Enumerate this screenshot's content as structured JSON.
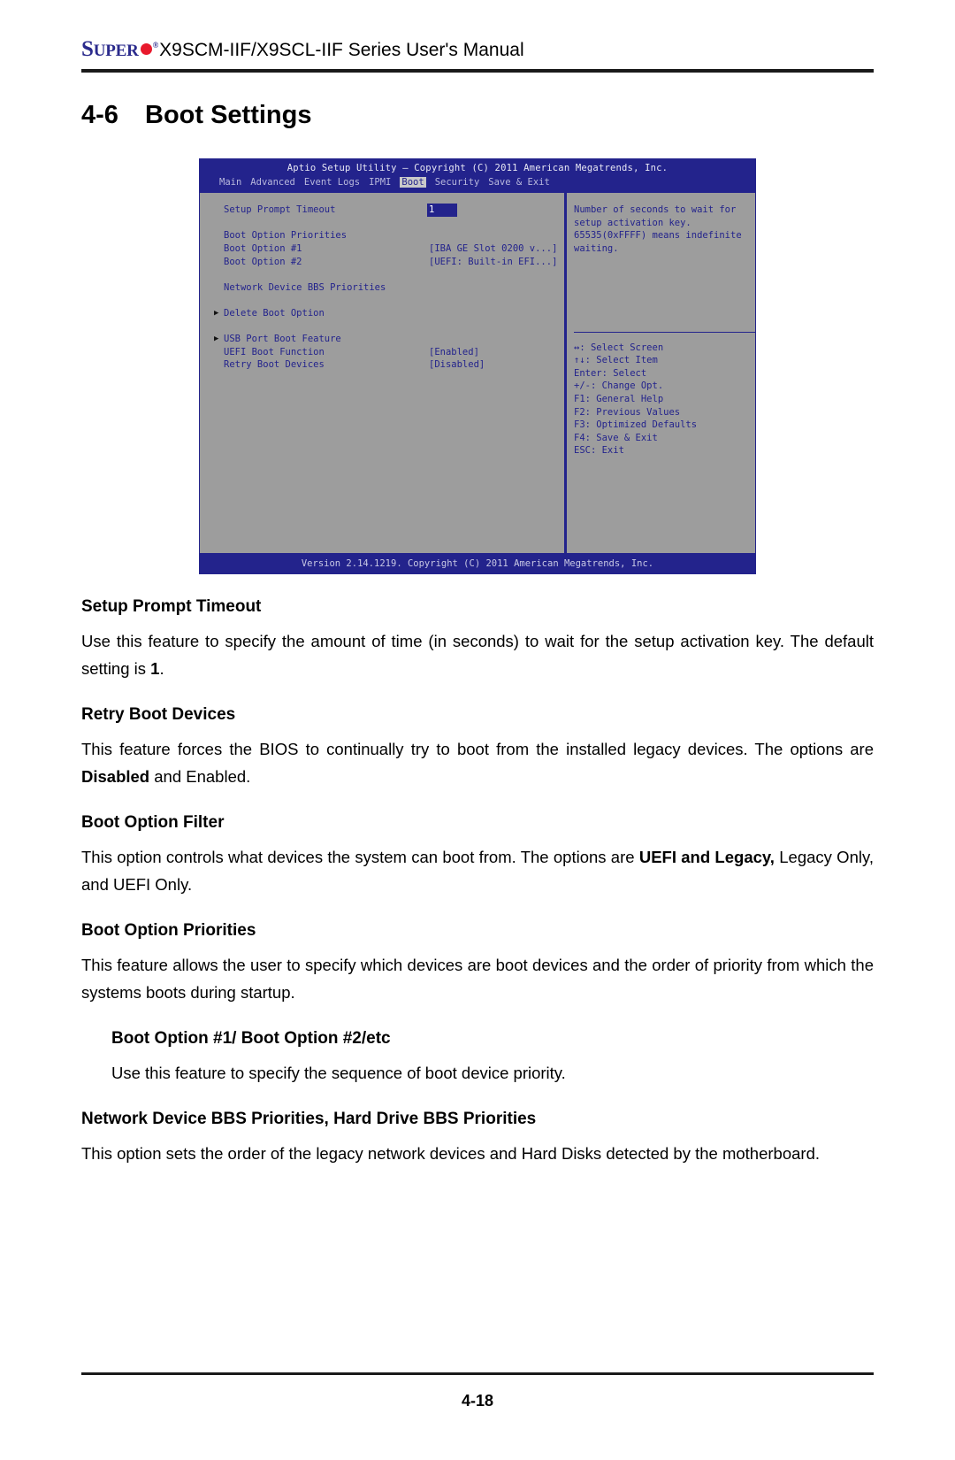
{
  "header": {
    "brand_super": "S",
    "brand_uper": "UPER",
    "brand_reg": "®",
    "title": "X9SCM-IIF/X9SCL-IIF Series User's Manual"
  },
  "section": {
    "number": "4-6",
    "title": "Boot Settings"
  },
  "bios": {
    "titlebar": "Aptio Setup Utility – Copyright (C) 2011 American Megatrends, Inc.",
    "menu": [
      {
        "label": "Main",
        "active": false
      },
      {
        "label": "Advanced",
        "active": false
      },
      {
        "label": "Event Logs",
        "active": false
      },
      {
        "label": "IPMI",
        "active": false
      },
      {
        "label": "Boot",
        "active": true
      },
      {
        "label": "Security",
        "active": false
      },
      {
        "label": "Save & Exit",
        "active": false
      }
    ],
    "rows": [
      {
        "arrow": "",
        "label": "Setup Prompt Timeout",
        "value": "1",
        "selected": true
      },
      {
        "arrow": "",
        "label": "",
        "value": "",
        "selected": false
      },
      {
        "arrow": "",
        "label": "Boot Option Priorities",
        "value": "",
        "selected": false
      },
      {
        "arrow": "",
        "label": "Boot Option #1",
        "value": "[IBA GE Slot 0200 v...]",
        "selected": false
      },
      {
        "arrow": "",
        "label": "Boot Option #2",
        "value": "[UEFI: Built-in EFI...]",
        "selected": false
      },
      {
        "arrow": "",
        "label": "",
        "value": "",
        "selected": false
      },
      {
        "arrow": "",
        "label": "Network Device BBS Priorities",
        "value": "",
        "selected": false
      },
      {
        "arrow": "",
        "label": "",
        "value": "",
        "selected": false
      },
      {
        "arrow": "▶",
        "label": "Delete Boot Option",
        "value": "",
        "selected": false
      },
      {
        "arrow": "",
        "label": "",
        "value": "",
        "selected": false
      },
      {
        "arrow": "▶",
        "label": "USB Port Boot Feature",
        "value": "",
        "selected": false
      },
      {
        "arrow": "",
        "label": "UEFI Boot Function",
        "value": "[Enabled]",
        "selected": false
      },
      {
        "arrow": "",
        "label": "Retry Boot Devices",
        "value": "[Disabled]",
        "selected": false
      }
    ],
    "help": "Number of seconds to wait for\nsetup activation key.\n65535(0xFFFF) means indefinite\nwaiting.",
    "keys": [
      "↔: Select Screen",
      "↑↓: Select Item",
      "Enter: Select",
      "+/-: Change Opt.",
      "F1: General Help",
      "F2: Previous Values",
      "F3: Optimized Defaults",
      "F4: Save & Exit",
      "ESC: Exit"
    ],
    "footer": "Version 2.14.1219. Copyright (C) 2011 American Megatrends, Inc."
  },
  "content": {
    "s1_head": "Setup Prompt Timeout",
    "s1_p1a": "Use this feature to specify the amount of time (in seconds) to wait for the setup activation key. The default setting is ",
    "s1_p1b": "1",
    "s1_p1c": ".",
    "s2_head": "Retry Boot Devices",
    "s2_p1a": "This feature forces the BIOS to continually try to boot from the installed legacy devices.  The options are ",
    "s2_p1b": "Disabled",
    "s2_p1c": " and Enabled.",
    "s3_head": "Boot Option Filter",
    "s3_p1a": "This option controls what devices the system can boot from.  The options are ",
    "s3_p1b": "UEFI and Legacy,",
    "s3_p1c": " Legacy Only, and UEFI Only.",
    "s4_head": "Boot Option Priorities",
    "s4_p1": "This feature allows the user to specify which devices are boot devices and the order of priority from which the systems boots during startup.",
    "s5_head": "Boot Option #1/ Boot Option #2/etc",
    "s5_p1": "Use this feature to specify the sequence of boot device priority.",
    "s6_head": "Network Device BBS Priorities, Hard Drive BBS Priorities",
    "s6_p1": "This option sets the order of the legacy network devices and Hard Disks detected by the motherboard."
  },
  "footer": {
    "page_number": "4-18"
  }
}
